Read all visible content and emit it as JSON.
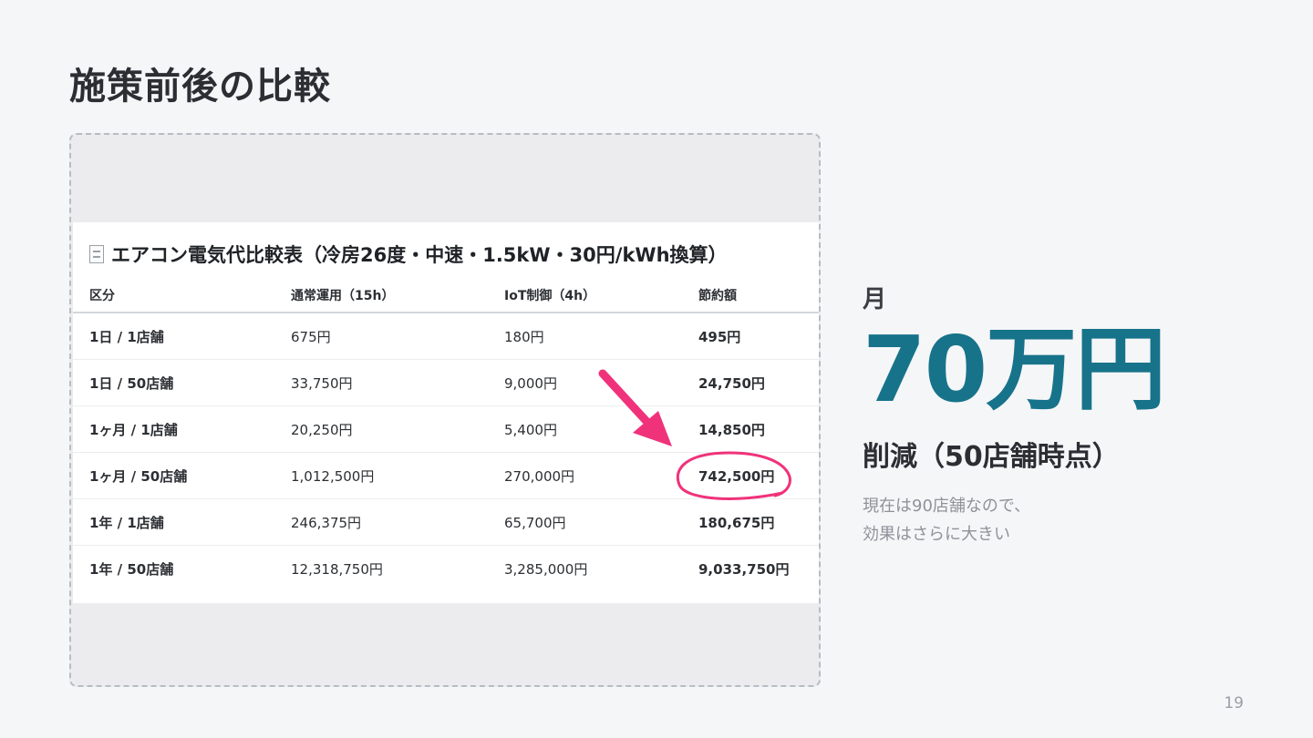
{
  "page": {
    "title": "施策前後の比較",
    "page_number": "19"
  },
  "sheet": {
    "title": "エアコン電気代比較表（冷房26度・中速・1.5kW・30円/kWh換算）",
    "title_icon": "document-icon",
    "headers": [
      "区分",
      "通常運用（15h）",
      "IoT制御（4h）",
      "節約額"
    ],
    "rows": [
      [
        "1日 / 1店舗",
        "675円",
        "180円",
        "495円"
      ],
      [
        "1日 / 50店舗",
        "33,750円",
        "9,000円",
        "24,750円"
      ],
      [
        "1ヶ月 / 1店舗",
        "20,250円",
        "5,400円",
        "14,850円"
      ],
      [
        "1ヶ月 / 50店舗",
        "1,012,500円",
        "270,000円",
        "742,500円"
      ],
      [
        "1年 / 1店舗",
        "246,375円",
        "65,700円",
        "180,675円"
      ],
      [
        "1年 / 50店舗",
        "12,318,750円",
        "3,285,000円",
        "9,033,750円"
      ]
    ]
  },
  "summary": {
    "month_label": "月",
    "amount": "70万円",
    "reduction_label": "削減（50店舗時点）",
    "note_line1": "現在は90店舗なので、",
    "note_line2": "効果はさらに大きい"
  },
  "colors": {
    "accent": "#17738a",
    "annotation": "#f0327a"
  }
}
